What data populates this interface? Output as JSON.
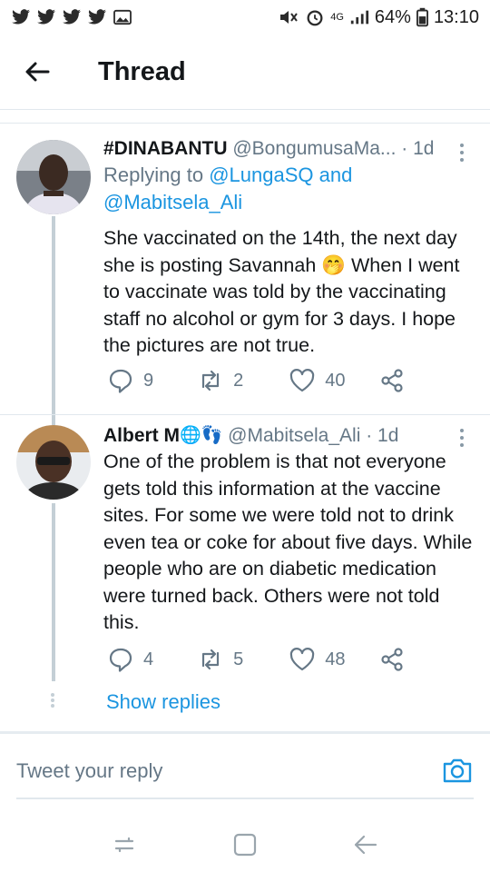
{
  "status_bar": {
    "network": "4G",
    "battery": "64%",
    "time": "13:10"
  },
  "header": {
    "title": "Thread"
  },
  "tweets": [
    {
      "name": "#DINABANTU",
      "handle": "@BongumusaMa...",
      "time": "· 1d",
      "replying_prefix": "Replying to",
      "replying_users": "@LungaSQ and @Mabitsela_Ali",
      "text": "She vaccinated on the 14th, the next day she is posting Savannah 🤭 When I went to vaccinate was told by the vaccinating staff no alcohol or gym for 3 days. I hope the pictures are not true.",
      "replies": "9",
      "retweets": "2",
      "likes": "40"
    },
    {
      "name": "Albert M",
      "name_emoji": "🌐👣",
      "handle": "@Mabitsela_Ali",
      "time": "· 1d",
      "text": "One of the problem is that not everyone gets told this information at the vaccine sites. For some we were told not to drink even tea or coke for about five days. While people who are on diabetic medication were turned back. Others were not told this.",
      "replies": "4",
      "retweets": "5",
      "likes": "48"
    }
  ],
  "show_replies": "Show replies",
  "reply_bar": {
    "placeholder": "Tweet your reply"
  },
  "colors": {
    "accent": "#1b95e0",
    "muted": "#657786",
    "text": "#14171a"
  }
}
